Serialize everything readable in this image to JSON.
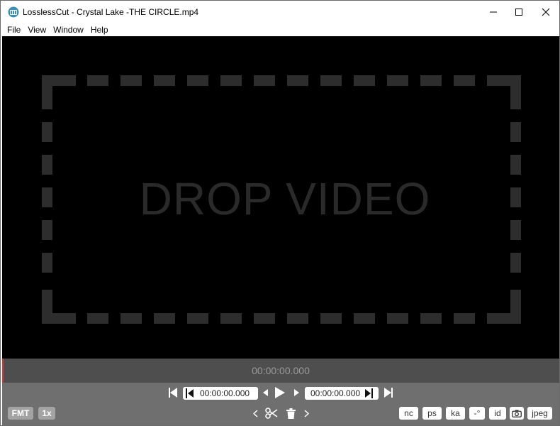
{
  "window": {
    "title": "LosslessCut - Crystal Lake -THE CIRCLE.mp4"
  },
  "menu": {
    "items": [
      "File",
      "View",
      "Window",
      "Help"
    ]
  },
  "video": {
    "drop_text": "DROP VIDEO"
  },
  "timeline": {
    "current_time": "00:00:00.000"
  },
  "controls": {
    "cut_start_time": "00:00:00.000",
    "cut_end_time": "00:00:00.000",
    "format_label": "FMT",
    "speed_label": "1x",
    "nc_label": "nc",
    "ps_label": "ps",
    "ka_label": "ka",
    "rotation_label": "-°",
    "id_label": "id",
    "jpeg_label": "jpeg"
  },
  "colors": {
    "playhead": "#e8312f",
    "timeline_bg": "#4e4e4e",
    "controls_bg": "#6f6f6f"
  }
}
